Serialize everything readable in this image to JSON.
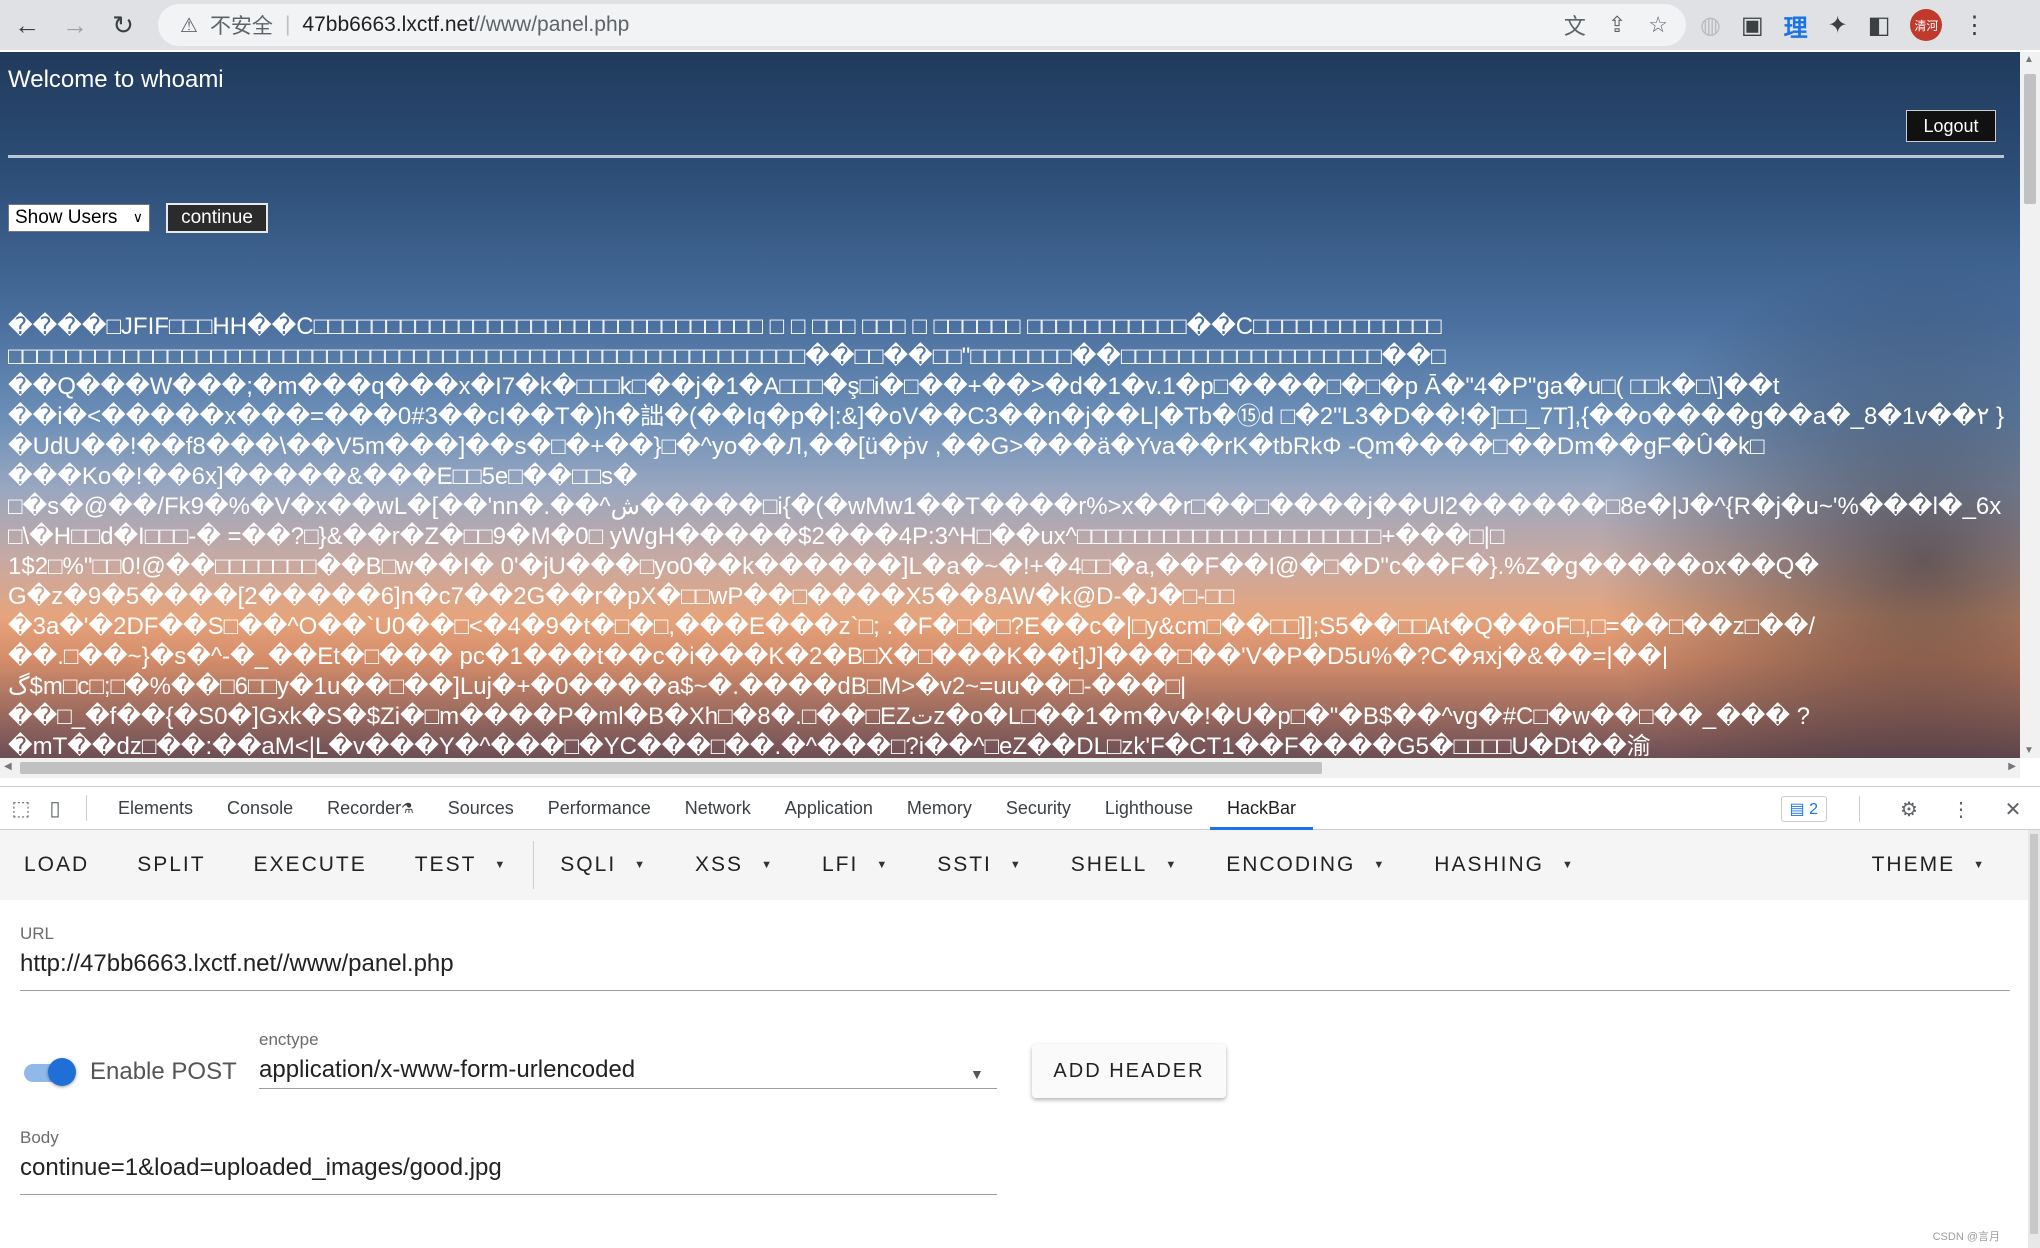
{
  "browser": {
    "security_label": "不安全",
    "url_host": "47bb6663.lxctf.net",
    "url_path": "//www/panel.php",
    "extension_text": "理",
    "avatar_text": "清河"
  },
  "page": {
    "welcome": "Welcome to whoami",
    "logout_label": "Logout",
    "select_value": "Show Users",
    "continue_label": "continue",
    "binary_lines": [
      "����□JFIF□□□HH��C□□□□□□□□□□□□□□□□□□□□□□□□□□□□□□□ □ □ □□□ □□□ □ □□□□□□ □□□□□□□□□□□��C□□□□□□□□□□□□□",
      "□□□□□□□□□□□□□□□□□□□□□□□□□□□□□□□□□□□□□□□□□□□□□□□□□□□□□□□��□□��□□\"□□□□□□□��□□□□□□□□□□□□□□□□□□��□",
      "��Q���W���;�m���q���x�I7�k�□□□k□��j�1�A□□□�ş□i�□��+��>�d�1�v.1�p□����□�□�p Ā�\"4�P\"ga�u□( □□k�□\\]��t",
      "��i�<�����x���=���0#3��cI��T�)h�詘�(��Iq�p�|:&]�oV��C3��n�j��L|�Tb�⑮d □�2\"L3�D��!�]□□_7T],{��o����g��a�_8�1v��٢ }",
      "�UdU��!��f8���\\��V5m���]��s�□�+��}□�^yo��Л,��[ü�ṗv ,��G>���ä�Yva��rK�tbRkΦ -Qm����□��Dm��gF�Û�k□",
      "���Ko�!��6x]�����&���E□□5e□��□□s�",
      "□�s�@��/Fk9�%�V�x��wL�[��'nn�.��^ش�����□i{�(�wMw1��T����r%>x��r□��□����j��Ul2������□8e�|J�^{R�j�u~'%���l�_6x",
      "□\\�H□□d�I□□□-� =��?□}&��r�Z�□□9�M�0□ yWgH�����$2���4P:3^H□��ux^□□□□□□□□□□□□□□□□□□□□□+���□|□",
      "1$2□%\"□□0!@��□□□□□□□��B□w��I� 0'�jU���□yo0��k������]L�a�~�!+�4□□�a,��F��I@�□�D\"c��F�}.%Z�g�����ox��Q�",
      "G�z�9�5����[2�����6]n�c7��2G��r�pX�□□wP��□����X5��8AW�k@D-�J�□-□□",
      "�3a�'�2DF��S□��^O��`U0��□<�4�9�t�□�□,���E���z`□; .�F�□�□?E��c�|□y&cm□��□□]];S5��□□At�Q��oF□,□=��□��z□��/",
      "��.□��~}�s�^-�_��Et�□��� pc�1���t��c�i���K�2�B□X�□���K��t]J]���□��'V�P�D5u%�?C�яхј�&��=|��|",
      "گ$m□c□;□�%��□6□□y�1u��□��]Luj�+�0����a$~�.����dB□M>�v2~=uu��□-���□|",
      "��□_�f��{�S0�]Gxk�S�$Zi�□m����P�ml�B�Xh□�8�.□��□EZتz�o�L□��1�m�v�!�U�p□�\"�B$��^vg�#C□�w��□��_��� ?",
      "�mT��dz□��:��aM<|L�v���Y�^���□�YC���□��.�^���□?i��^□eZ��DL□zk'F�CT1��F����G5�□□□□U�Dt��渝"
    ]
  },
  "devtools": {
    "tabs": [
      "Elements",
      "Console",
      "Recorder",
      "Sources",
      "Performance",
      "Network",
      "Application",
      "Memory",
      "Security",
      "Lighthouse",
      "HackBar"
    ],
    "active_tab": "HackBar",
    "issues_count": "2"
  },
  "hackbar": {
    "toolbar": [
      {
        "label": "LOAD",
        "dropdown": false
      },
      {
        "label": "SPLIT",
        "dropdown": false
      },
      {
        "label": "EXECUTE",
        "dropdown": false
      },
      {
        "label": "TEST",
        "dropdown": true
      },
      {
        "label": "SQLI",
        "dropdown": true
      },
      {
        "label": "XSS",
        "dropdown": true
      },
      {
        "label": "LFI",
        "dropdown": true
      },
      {
        "label": "SSTI",
        "dropdown": true
      },
      {
        "label": "SHELL",
        "dropdown": true
      },
      {
        "label": "ENCODING",
        "dropdown": true
      },
      {
        "label": "HASHING",
        "dropdown": true
      },
      {
        "label": "THEME",
        "dropdown": true
      }
    ],
    "url_label": "URL",
    "url_value": "http://47bb6663.lxctf.net//www/panel.php",
    "enable_post_label": "Enable POST",
    "enable_post_on": true,
    "enctype_label": "enctype",
    "enctype_value": "application/x-www-form-urlencoded",
    "add_header_label": "ADD HEADER",
    "body_label": "Body",
    "body_value": "continue=1&load=uploaded_images/good.jpg"
  },
  "watermark": "CSDN @言月"
}
